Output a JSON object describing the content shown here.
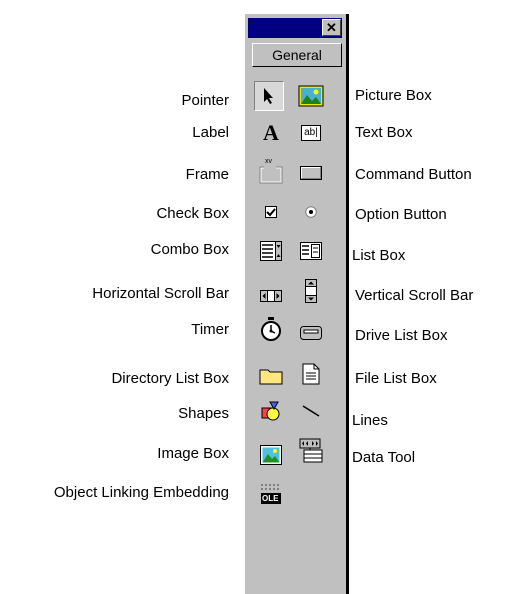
{
  "toolbox": {
    "close_glyph": "✕",
    "tab_label": "General"
  },
  "tools": {
    "pointer": "Pointer",
    "picture_box": "Picture Box",
    "label": "Label",
    "text_box": "Text Box",
    "frame": "Frame",
    "command_button": "Command Button",
    "check_box": "Check Box",
    "option_button": "Option Button",
    "combo_box": "Combo Box",
    "list_box": "List Box",
    "hscroll": "Horizontal Scroll Bar",
    "vscroll": "Vertical Scroll Bar",
    "timer": "Timer",
    "drive_list": "Drive List Box",
    "dir_list": "Directory List Box",
    "file_list": "File List Box",
    "shapes": "Shapes",
    "lines": "Lines",
    "image_box": "Image Box",
    "data_tool": "Data Tool",
    "ole": "Object Linking Embedding"
  },
  "icons": {
    "label_glyph": "A",
    "textbox_glyph": "ab|",
    "frame_glyph": "xv",
    "ole_glyph": "OLE"
  },
  "colors": {
    "titlebar": "#000080",
    "panel": "#c0c0c0"
  }
}
